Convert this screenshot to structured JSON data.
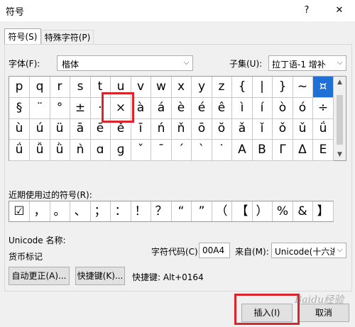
{
  "window": {
    "title": "符号",
    "help_label": "?",
    "close_label": "✕"
  },
  "tabs": [
    {
      "label": "符号(S)"
    },
    {
      "label": "特殊字符(P)"
    }
  ],
  "font": {
    "label": "字体(F):",
    "value": "楷体"
  },
  "subset": {
    "label": "子集(U):",
    "value": "拉丁语-1 增补"
  },
  "grid": {
    "rows": [
      [
        "p",
        "q",
        "r",
        "s",
        "t",
        "u",
        "v",
        "w",
        "x",
        "y",
        "z",
        "{",
        "|",
        "}",
        "~",
        "¤"
      ],
      [
        "§",
        "¨",
        "°",
        "±",
        "·",
        "×",
        "à",
        "á",
        "è",
        "é",
        "ê",
        "ì",
        "í",
        "ò",
        "ó",
        "÷"
      ],
      [
        "ù",
        "ú",
        "ü",
        "ā",
        "ē",
        "ě",
        "ī",
        "ń",
        "ň",
        "ō",
        "ŏ",
        "ǎ",
        "ǐ",
        "ǒ",
        "ǔ",
        "ǘ"
      ],
      [
        "ǘ",
        "ǚ",
        "ǜ",
        "ǹ",
        "ɑ",
        "ɡ",
        "ˇ",
        "ˉ",
        "ˊ",
        "ˋ",
        "˙",
        "Α",
        "Β",
        "Γ",
        "Δ",
        "Ε"
      ]
    ]
  },
  "recent": {
    "label": "近期使用过的符号(R):",
    "symbols": [
      "☑",
      "，",
      "。",
      "、",
      "；",
      "：",
      "！",
      "？",
      "“",
      "”",
      "（",
      "【",
      "）",
      "%",
      "&",
      "】"
    ]
  },
  "unicode": {
    "name_label": "Unicode 名称:",
    "name_value": "货币标记"
  },
  "char_code": {
    "label": "字符代码(C):",
    "value": "00A4"
  },
  "from": {
    "label": "来自(M):",
    "value": "Unicode(十六进"
  },
  "buttons": {
    "autocorrect": "自动更正(A)...",
    "shortcut_key": "快捷键(K)...",
    "insert": "插入(I)",
    "cancel": "取消"
  },
  "shortcut": {
    "text": "快捷键: Alt+0164"
  },
  "watermark": "Baidu经验",
  "colors": {
    "selection": "#1e6fd6",
    "highlight_box": "#d9252b"
  }
}
